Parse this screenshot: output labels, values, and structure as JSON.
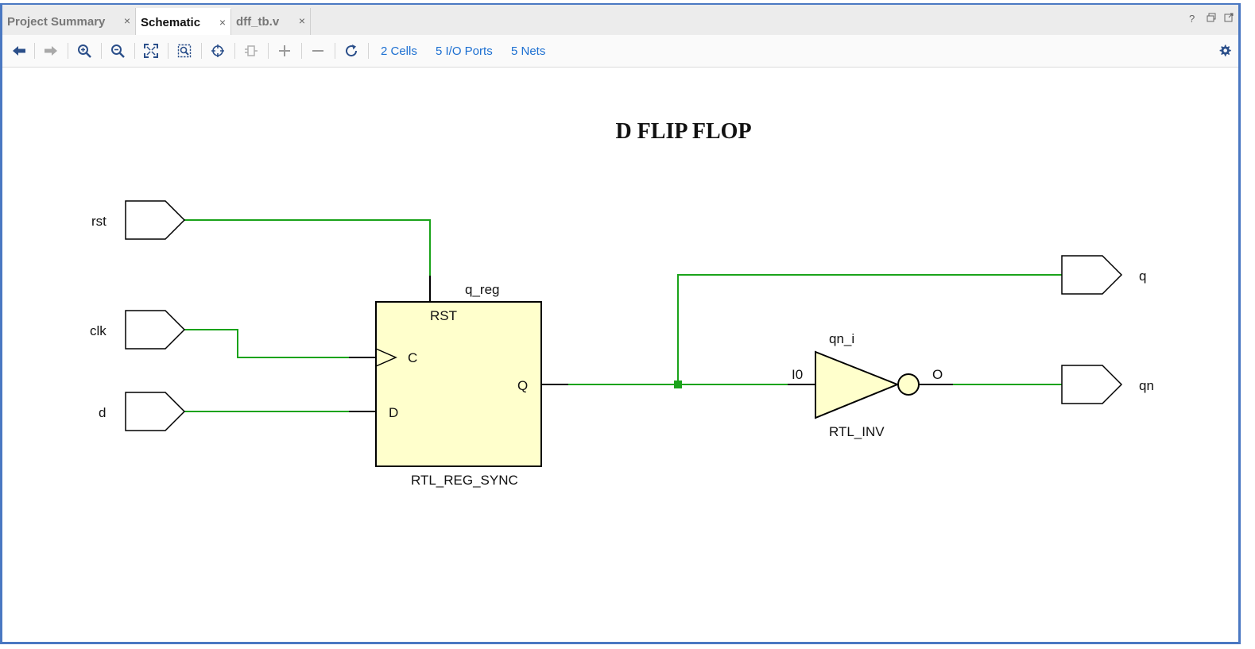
{
  "tabs": [
    {
      "label": "Project Summary",
      "active": false
    },
    {
      "label": "Schematic",
      "active": true
    },
    {
      "label": "dff_tb.v",
      "active": false
    }
  ],
  "tab_close_glyph": "×",
  "window_controls": {
    "help": "?",
    "restore_icon": "restore-icon",
    "float_icon": "float-icon"
  },
  "toolbar": {
    "buttons": [
      "back-icon",
      "forward-icon",
      "zoom-in-icon",
      "zoom-out-icon",
      "zoom-fit-icon",
      "zoom-area-icon",
      "select-icon",
      "expand-icon",
      "add-icon",
      "remove-icon",
      "refresh-icon"
    ],
    "cells_label": "2 Cells",
    "io_ports_label": "5 I/O Ports",
    "nets_label": "5 Nets",
    "settings_icon": "gear-icon"
  },
  "schematic": {
    "title": "D FLIP FLOP",
    "input_ports": [
      "rst",
      "clk",
      "d"
    ],
    "output_ports": [
      "q",
      "qn"
    ],
    "register": {
      "instance": "q_reg",
      "type": "RTL_REG_SYNC",
      "pins": {
        "rst": "RST",
        "clk": "C",
        "d": "D",
        "q": "Q"
      }
    },
    "inverter": {
      "instance": "qn_i",
      "type": "RTL_INV",
      "pins": {
        "in": "I0",
        "out": "O"
      }
    },
    "colors": {
      "wire": "#1aa31a",
      "cell_fill": "#ffffcc",
      "outline": "#000000",
      "frame": "#4a78c2",
      "link": "#1c6fd1"
    }
  }
}
